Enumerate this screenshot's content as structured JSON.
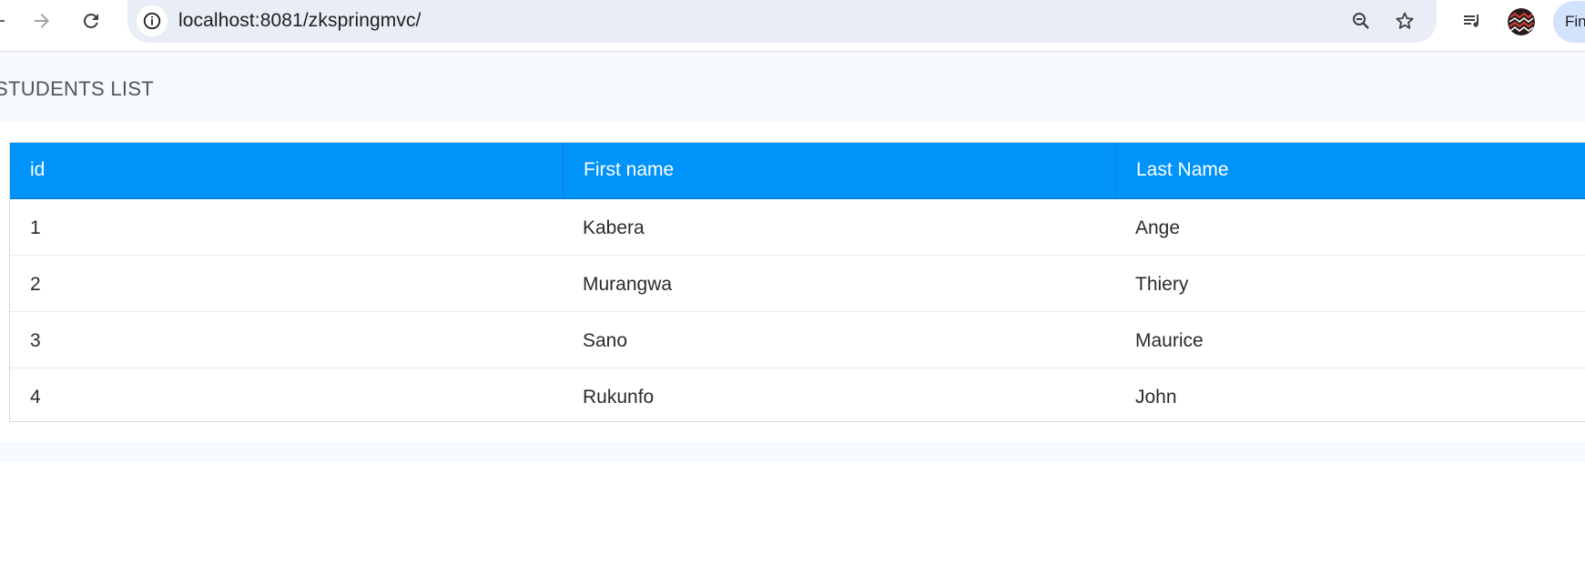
{
  "browser": {
    "url": "localhost:8081/zkspringmvc/",
    "profile_label": "Finish update"
  },
  "page": {
    "title": "STUDENTS LIST"
  },
  "table": {
    "columns": [
      "id",
      "First name",
      "Last Name"
    ],
    "rows": [
      [
        "1",
        "Kabera",
        "Ange"
      ],
      [
        "2",
        "Murangwa",
        "Thiery"
      ],
      [
        "3",
        "Sano",
        "Maurice"
      ],
      [
        "4",
        "Rukunfo",
        "John"
      ]
    ]
  },
  "colors": {
    "header_bg": "#0093f9",
    "header_text": "#ffffff",
    "panel_bg": "#f6f9fd",
    "omnibox_bg": "#e9edf6"
  },
  "icons": [
    "back-icon",
    "forward-icon",
    "reload-icon",
    "site-info-icon",
    "zoom-icon",
    "bookmark-star-icon",
    "media-controls-icon"
  ]
}
